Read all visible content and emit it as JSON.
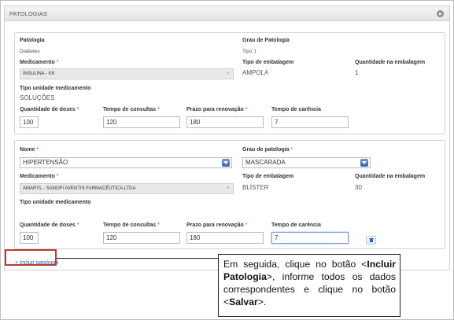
{
  "panel": {
    "title": "PATOLOGIAS"
  },
  "card1": {
    "patologia_label": "Patologia",
    "patologia_value": "Diabetes",
    "grau_label": "Grau de Patologia",
    "grau_value": "Tipo 1",
    "medicamento_label": "Medicamento",
    "medicamento_value": "INSULINA - KK",
    "tipo_embalagem_label": "Tipo de embalagem",
    "tipo_embalagem_value": "AMPOLA",
    "qtd_embalagem_label": "Quantidade na embalagem",
    "qtd_embalagem_value": "1",
    "tipo_unidade_label": "Tipo unidade medicamento",
    "tipo_unidade_value": "SOLUÇÕES",
    "qtd_doses_label": "Quantidade de doses",
    "qtd_doses_value": "100",
    "tempo_consultas_label": "Tempo de consultas",
    "tempo_consultas_value": "120",
    "prazo_label": "Prazo para renovação",
    "prazo_value": "180",
    "carencia_label": "Tempo de carência",
    "carencia_value": "7"
  },
  "card2": {
    "nome_label": "Nome",
    "nome_value": "HIPERTENSÃO",
    "grau_label": "Grau de patologia",
    "grau_value": "MASCARADA",
    "medicamento_label": "Medicamento",
    "medicamento_value": "AMARYL - SANOFI AVENTIS FARMACÊUTICA LTDA",
    "tipo_embalagem_label": "Tipo de embalagem",
    "tipo_embalagem_value": "BLÍSTER",
    "qtd_embalagem_label": "Quantidade na embalagem",
    "qtd_embalagem_value": "30",
    "tipo_unidade_label": "Tipo unidade medicamento",
    "qtd_doses_label": "Quantidade de doses",
    "qtd_doses_value": "100",
    "tempo_consultas_label": "Tempo de consultas",
    "tempo_consultas_value": "120",
    "prazo_label": "Prazo para renovação",
    "prazo_value": "180",
    "carencia_label": "Tempo de carência",
    "carencia_value": "7"
  },
  "required_mark": "*",
  "clear_glyph": "×",
  "add_link": "+ Incluir patologia",
  "callout": {
    "text1": "Em seguida, clique no botão <",
    "bold1": "Incluir Patologia",
    "text2": ">, informe todos os dados correspondentes e clique no botão <",
    "bold2": "Salvar",
    "text3": ">."
  },
  "colors": {
    "link": "#2a5aa8",
    "required": "#cc2222",
    "highlight": "#c0392b",
    "select_arrow": "#3d66b3"
  },
  "icons": {
    "collapse": "collapse-icon",
    "dropdown": "chevron-down-icon",
    "delete": "trash-icon",
    "clear": "close-icon"
  }
}
